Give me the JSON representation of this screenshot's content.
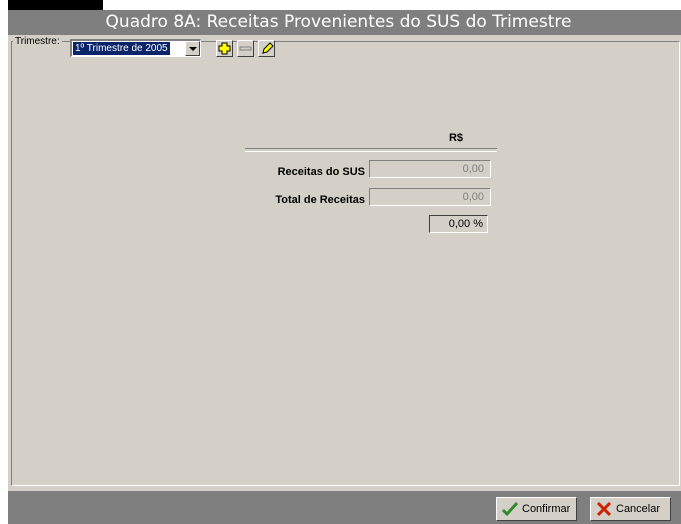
{
  "window": {
    "title": "Quadro 8A: Receitas Provenientes do SUS do Trimestre"
  },
  "filter": {
    "label": "Trimestre:",
    "selected": "1º Trimestre de 2005"
  },
  "toolbar": {
    "icons": [
      "plus-icon",
      "minus-icon",
      "pencil-icon"
    ]
  },
  "table": {
    "currency_header": "R$",
    "rows": [
      {
        "label": "Receitas do SUS",
        "value": "0,00"
      },
      {
        "label": "Total de Receitas",
        "value": "0,00"
      }
    ],
    "percentage": "0,00 %"
  },
  "buttons": {
    "confirm": "Confirmar",
    "cancel": "Cancelar"
  },
  "colors": {
    "titlebar": "#7f7f7f",
    "panel": "#d4d0c8",
    "selection": "#0a246a",
    "confirm_icon": "#2e8b2e",
    "cancel_icon": "#cc2200"
  }
}
